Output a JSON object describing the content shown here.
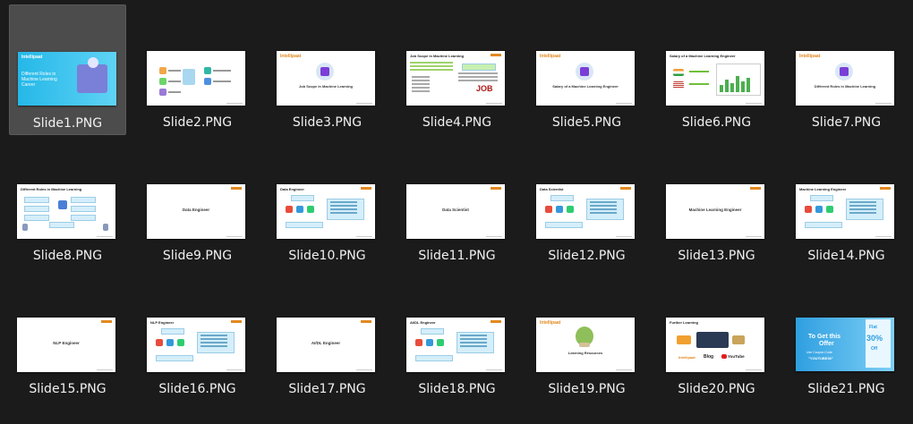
{
  "files": [
    {
      "name": "Slide1.PNG",
      "selected": true,
      "slide": {
        "kind": "title",
        "logo": "Intellipaat",
        "title": "Different Roles in Machine Learning Career"
      }
    },
    {
      "name": "Slide2.PNG",
      "slide": {
        "kind": "agenda"
      }
    },
    {
      "name": "Slide3.PNG",
      "slide": {
        "kind": "section",
        "logo": "Intellipaat",
        "text": "Job Scope in Machine Learning"
      }
    },
    {
      "name": "Slide4.PNG",
      "slide": {
        "kind": "jobscope",
        "heading": "Job Scope in Machine Learning",
        "badge": "JOB"
      }
    },
    {
      "name": "Slide5.PNG",
      "slide": {
        "kind": "section",
        "logo": "Intellipaat",
        "text": "Salary of a Machine Learning Engineer"
      }
    },
    {
      "name": "Slide6.PNG",
      "slide": {
        "kind": "salary",
        "heading": "Salary of a Machine Learning Engineer"
      }
    },
    {
      "name": "Slide7.PNG",
      "slide": {
        "kind": "section",
        "logo": "Intellipaat",
        "text": "Different Roles in Machine Learning"
      }
    },
    {
      "name": "Slide8.PNG",
      "slide": {
        "kind": "roles",
        "heading": "Different Roles in Machine Learning"
      }
    },
    {
      "name": "Slide9.PNG",
      "slide": {
        "kind": "plain",
        "text": "Data Engineer"
      }
    },
    {
      "name": "Slide10.PNG",
      "slide": {
        "kind": "detail",
        "heading": "Data Engineer"
      }
    },
    {
      "name": "Slide11.PNG",
      "slide": {
        "kind": "plain",
        "text": "Data Scientist"
      }
    },
    {
      "name": "Slide12.PNG",
      "slide": {
        "kind": "detail",
        "heading": "Data Scientist"
      }
    },
    {
      "name": "Slide13.PNG",
      "slide": {
        "kind": "plain",
        "text": "Machine Learning Engineer"
      }
    },
    {
      "name": "Slide14.PNG",
      "slide": {
        "kind": "detail",
        "heading": "Machine Learning Engineer"
      }
    },
    {
      "name": "Slide15.PNG",
      "slide": {
        "kind": "plain",
        "text": "NLP Engineer"
      }
    },
    {
      "name": "Slide16.PNG",
      "slide": {
        "kind": "detail",
        "heading": "NLP Engineer"
      }
    },
    {
      "name": "Slide17.PNG",
      "slide": {
        "kind": "plain",
        "text": "AI/DL Engineer"
      }
    },
    {
      "name": "Slide18.PNG",
      "slide": {
        "kind": "detail",
        "heading": "AI/DL Engineer"
      }
    },
    {
      "name": "Slide19.PNG",
      "slide": {
        "kind": "resources",
        "logo": "Intellipaat",
        "text": "Learning Resources"
      }
    },
    {
      "name": "Slide20.PNG",
      "slide": {
        "kind": "further",
        "heading": "Further Learning",
        "logo": "Intellipaat",
        "blog": "Blog",
        "yt": "YouTube"
      }
    },
    {
      "name": "Slide21.PNG",
      "slide": {
        "kind": "offer",
        "line1": "To Get this",
        "line2": "Offer",
        "line3": "Use Coupon Code",
        "code": "\"YOUTUBE30\"",
        "flat": "Flat",
        "pct": "30%",
        "off": "Off"
      }
    }
  ]
}
